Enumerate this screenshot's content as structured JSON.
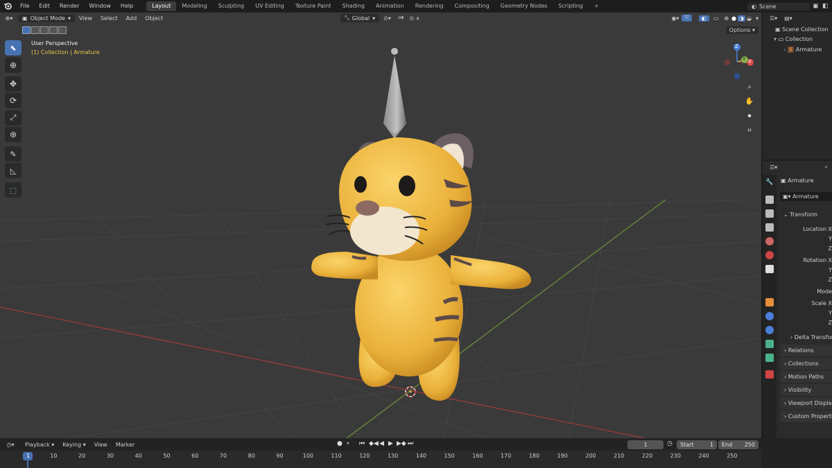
{
  "topbar": {
    "menus": [
      "File",
      "Edit",
      "Render",
      "Window",
      "Help"
    ],
    "workspaces": [
      "Layout",
      "Modeling",
      "Sculpting",
      "UV Editing",
      "Texture Paint",
      "Shading",
      "Animation",
      "Rendering",
      "Compositing",
      "Geometry Nodes",
      "Scripting"
    ],
    "active_workspace": "Layout",
    "add_tab": "+",
    "scene": "Scene"
  },
  "viewport": {
    "mode": "Object Mode",
    "menus": [
      "View",
      "Select",
      "Add",
      "Object"
    ],
    "orientation": "Global",
    "options": "Options",
    "overlay_title": "User Perspective",
    "overlay_subtitle": "(1) Collection | Armature",
    "gizmo_z": "Z",
    "gizmo_y": "Y",
    "gizmo_x": "X"
  },
  "outliner": {
    "items": [
      {
        "label": "Scene Collection"
      },
      {
        "label": "Collection"
      },
      {
        "label": "Armature"
      }
    ]
  },
  "properties": {
    "object_name": "Armature",
    "data_name": "Armature",
    "transform_title": "Transform",
    "fields": [
      "Location X",
      "Y",
      "Z",
      "Rotation X",
      "Y",
      "Z",
      "Mode",
      "Scale X",
      "Y",
      "Z"
    ],
    "delta": "Delta Transform",
    "panels": [
      "Relations",
      "Collections",
      "Motion Paths",
      "Visibility",
      "Viewport Display",
      "Custom Properties"
    ]
  },
  "timeline": {
    "menus": [
      "Playback",
      "Keying",
      "View",
      "Marker"
    ],
    "current_frame": "1",
    "start_label": "Start",
    "start_value": "1",
    "end_label": "End",
    "end_value": "250",
    "ruler": [
      "1",
      "10",
      "20",
      "30",
      "40",
      "50",
      "60",
      "70",
      "80",
      "90",
      "100",
      "110",
      "120",
      "130",
      "140",
      "150",
      "160",
      "170",
      "180",
      "190",
      "200",
      "210",
      "220",
      "230",
      "240",
      "250"
    ]
  },
  "colors": {
    "accent": "#4772b3",
    "overlay_subtitle": "#e6c84a",
    "x_axis": "#9b3b3b",
    "y_axis": "#6a8e3a",
    "tiger_body": "#f0b83c"
  }
}
